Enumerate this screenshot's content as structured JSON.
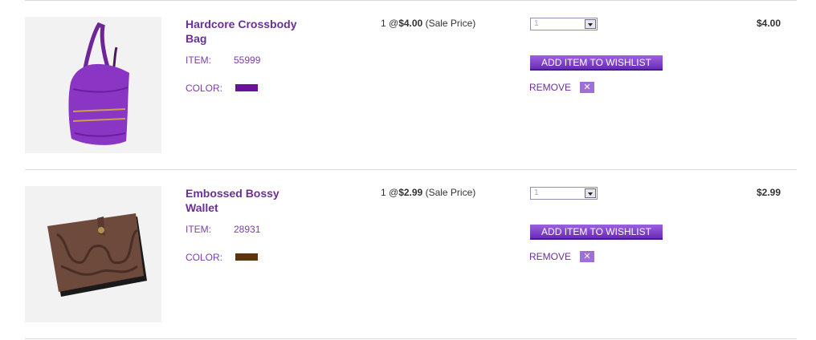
{
  "cart_items": [
    {
      "name_line1": "Hardcore Crossbody",
      "name_line2": "Bag",
      "item_label": "ITEM:",
      "item_number": "55999",
      "color_label": "COLOR:",
      "color_hex": "#6b1396",
      "qty_prefix": "1 @",
      "unit_price": "$4.00",
      "price_note": "(Sale Price)",
      "quantity": "1",
      "wishlist_label": "ADD ITEM TO WISHLIST",
      "remove_label": "REMOVE",
      "remove_icon": "✕",
      "line_total": "$4.00",
      "image_icon": "crossbody-bag-photo"
    },
    {
      "name_line1": "Embossed Bossy",
      "name_line2": "Wallet",
      "item_label": "ITEM:",
      "item_number": "28931",
      "color_label": "COLOR:",
      "color_hex": "#5a3413",
      "qty_prefix": "1 @",
      "unit_price": "$2.99",
      "price_note": "(Sale Price)",
      "quantity": "1",
      "wishlist_label": "ADD ITEM TO WISHLIST",
      "remove_label": "REMOVE",
      "remove_icon": "✕",
      "line_total": "$2.99",
      "image_icon": "embossed-wallet-photo"
    }
  ]
}
